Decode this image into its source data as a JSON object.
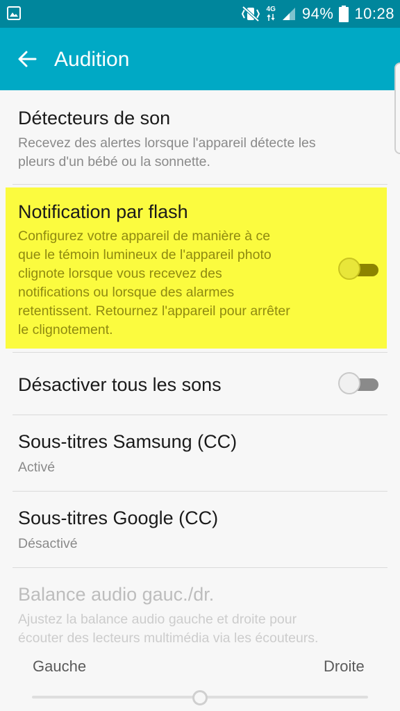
{
  "status_bar": {
    "battery_percent": "94%",
    "time": "10:28",
    "network_type": "4G",
    "icons": [
      "gallery-icon",
      "mute-vibrate-icon",
      "data-arrows-icon",
      "signal-icon",
      "battery-icon"
    ]
  },
  "app_bar": {
    "title": "Audition",
    "back_icon": "arrow-left-icon"
  },
  "settings": {
    "sound_detectors": {
      "title": "Détecteurs de son",
      "line1": "Recevez des alertes lorsque l'appareil détecte les",
      "line2": "pleurs d'un bébé ou la sonnette."
    },
    "flash_notification": {
      "title": "Notification par flash",
      "lines": [
        "Configurez votre appareil de manière à ce",
        "que le témoin lumineux de l'appareil photo",
        "clignote lorsque vous recevez des",
        "notifications ou lorsque des alarmes",
        "retentissent. Retournez l'appareil pour arrêter",
        "le clignotement."
      ],
      "toggle_on": false
    },
    "mute_all": {
      "title": "Désactiver tous les sons",
      "toggle_on": false
    },
    "samsung_subtitles": {
      "title": "Sous-titres Samsung (CC)",
      "value": "Activé"
    },
    "google_subtitles": {
      "title": "Sous-titres Google (CC)",
      "value": "Désactivé"
    },
    "audio_balance": {
      "title": "Balance audio gauc./dr.",
      "line1": "Ajustez la balance audio gauche et droite pour",
      "line2": "écouter des lecteurs multimédia via les écouteurs.",
      "left_label": "Gauche",
      "right_label": "Droite",
      "balance_fraction": 0.5,
      "enabled": false
    }
  },
  "colors": {
    "status_bar": "#00869c",
    "app_bar": "#00a9c5",
    "highlight": "#fbfb3f",
    "toggle_track_off": "#8a8a8a",
    "toggle_thumb_off": "#f1f1f1",
    "toggle_on_highlight_track": "#8c8400",
    "toggle_on_highlight_thumb": "#e8e63a"
  }
}
